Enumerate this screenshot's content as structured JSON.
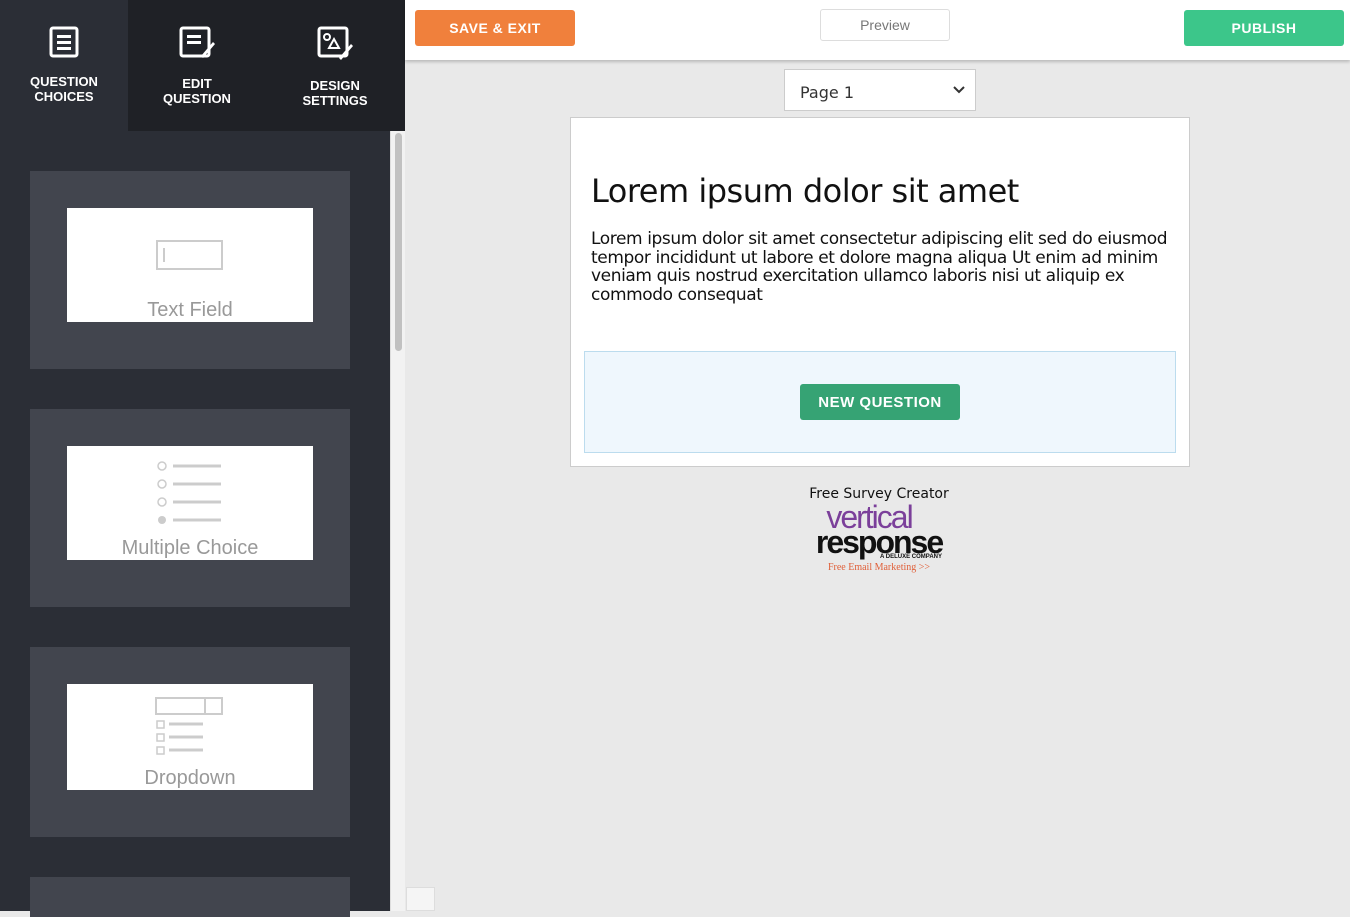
{
  "sidebar": {
    "tabs": [
      {
        "label1": "QUESTION",
        "label2": "CHOICES"
      },
      {
        "label1": "EDIT",
        "label2": "QUESTION"
      },
      {
        "label1": "DESIGN",
        "label2": "SETTINGS"
      }
    ],
    "choices": [
      "Text Field",
      "Multiple Choice",
      "Dropdown"
    ]
  },
  "toolbar": {
    "save_exit": "SAVE & EXIT",
    "preview": "Preview",
    "publish": "PUBLISH",
    "page_select": "Page 1"
  },
  "survey": {
    "title": "Lorem ipsum dolor sit amet",
    "body": "Lorem ipsum dolor sit amet consectetur adipiscing elit sed do eiusmod tempor incididunt ut labore et dolore magna aliqua Ut enim ad minim veniam quis nostrud exercitation ullamco laboris nisi ut aliquip ex commodo consequat",
    "new_question": "NEW QUESTION"
  },
  "footer": {
    "caption": "Free Survey Creator",
    "logo1": "vertical",
    "logo2": "response",
    "logo3": "A DELUXE COMPANY",
    "link": "Free Email Marketing >>"
  }
}
